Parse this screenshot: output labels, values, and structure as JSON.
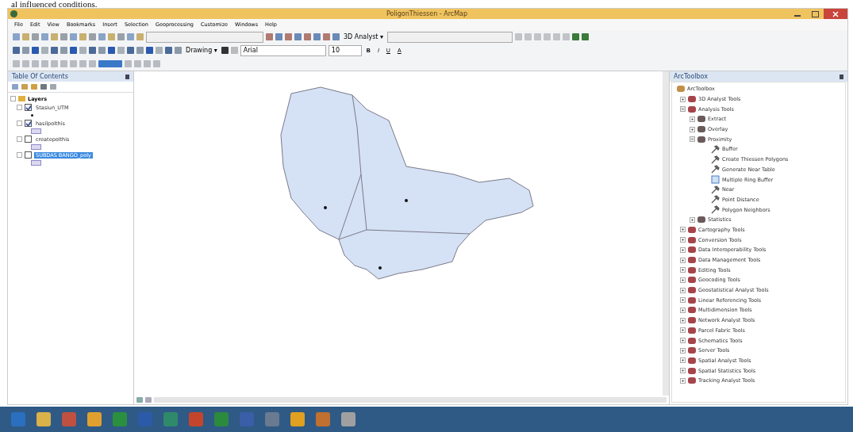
{
  "document_text": "al influenced conditions.",
  "window": {
    "title": "PoligonThiessen - ArcMap"
  },
  "menu": [
    "File",
    "Edit",
    "View",
    "Bookmarks",
    "Insert",
    "Selection",
    "Geoprocessing",
    "Customize",
    "Windows",
    "Help"
  ],
  "toolbar": {
    "analyst_menu": "3D Analyst ▾",
    "drawing_menu": "Drawing ▾",
    "font": "Arial",
    "font_size": "10",
    "bold": "B",
    "italic": "I",
    "underline": "U",
    "text_color": "A"
  },
  "toc": {
    "title": "Table Of Contents",
    "group": "Layers",
    "layers": [
      {
        "name": "Stasiun_UTM",
        "checked": true,
        "selected": false,
        "kind": "point"
      },
      {
        "name": "hasilpolthis",
        "checked": true,
        "selected": false,
        "kind": "polygon"
      },
      {
        "name": "createpolthis",
        "checked": false,
        "selected": false,
        "kind": "polygon"
      },
      {
        "name": "SUBDAS BANGO_poly",
        "checked": false,
        "selected": true,
        "kind": "polygon"
      }
    ]
  },
  "toolbox": {
    "title": "ArcToolbox",
    "root": "ArcToolbox",
    "items": [
      {
        "name": "3D Analyst Tools",
        "kind": "toolbox",
        "expanded": false
      },
      {
        "name": "Analysis Tools",
        "kind": "toolbox",
        "expanded": true,
        "children": [
          {
            "name": "Extract",
            "kind": "toolset",
            "expanded": false
          },
          {
            "name": "Overlay",
            "kind": "toolset",
            "expanded": false
          },
          {
            "name": "Proximity",
            "kind": "toolset",
            "expanded": true,
            "children": [
              {
                "name": "Buffer",
                "kind": "tool"
              },
              {
                "name": "Create Thiessen Polygons",
                "kind": "tool"
              },
              {
                "name": "Generate Near Table",
                "kind": "tool"
              },
              {
                "name": "Multiple Ring Buffer",
                "kind": "script"
              },
              {
                "name": "Near",
                "kind": "tool"
              },
              {
                "name": "Point Distance",
                "kind": "tool"
              },
              {
                "name": "Polygon Neighbors",
                "kind": "tool"
              }
            ]
          },
          {
            "name": "Statistics",
            "kind": "toolset",
            "expanded": false
          }
        ]
      },
      {
        "name": "Cartography Tools",
        "kind": "toolbox",
        "expanded": false
      },
      {
        "name": "Conversion Tools",
        "kind": "toolbox",
        "expanded": false
      },
      {
        "name": "Data Interoperability Tools",
        "kind": "toolbox",
        "expanded": false
      },
      {
        "name": "Data Management Tools",
        "kind": "toolbox",
        "expanded": false
      },
      {
        "name": "Editing Tools",
        "kind": "toolbox",
        "expanded": false
      },
      {
        "name": "Geocoding Tools",
        "kind": "toolbox",
        "expanded": false
      },
      {
        "name": "Geostatistical Analyst Tools",
        "kind": "toolbox",
        "expanded": false
      },
      {
        "name": "Linear Referencing Tools",
        "kind": "toolbox",
        "expanded": false
      },
      {
        "name": "Multidimension Tools",
        "kind": "toolbox",
        "expanded": false
      },
      {
        "name": "Network Analyst Tools",
        "kind": "toolbox",
        "expanded": false
      },
      {
        "name": "Parcel Fabric Tools",
        "kind": "toolbox",
        "expanded": false
      },
      {
        "name": "Schematics Tools",
        "kind": "toolbox",
        "expanded": false
      },
      {
        "name": "Server Tools",
        "kind": "toolbox",
        "expanded": false
      },
      {
        "name": "Spatial Analyst Tools",
        "kind": "toolbox",
        "expanded": false
      },
      {
        "name": "Spatial Statistics Tools",
        "kind": "toolbox",
        "expanded": false
      },
      {
        "name": "Tracking Analyst Tools",
        "kind": "toolbox",
        "expanded": false
      }
    ]
  }
}
